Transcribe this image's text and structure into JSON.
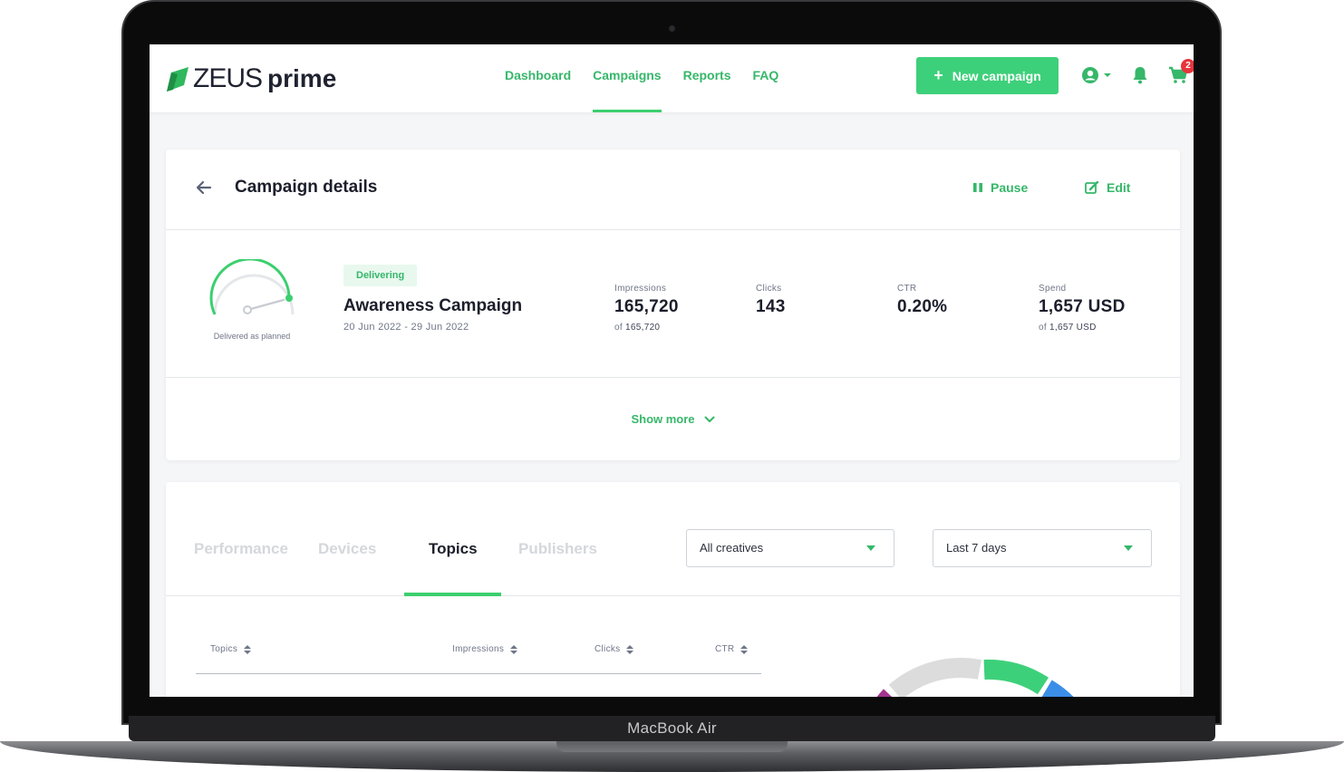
{
  "device": {
    "label": "MacBook Air"
  },
  "header": {
    "logo_main": "ZEUS",
    "logo_sub": "prime",
    "nav": [
      {
        "label": "Dashboard"
      },
      {
        "label": "Campaigns"
      },
      {
        "label": "Reports"
      },
      {
        "label": "FAQ"
      }
    ],
    "active_nav": "Campaigns",
    "new_campaign_label": "New campaign",
    "cart_count": "2",
    "icons": [
      "user-circle-icon",
      "bell-icon",
      "cart-icon"
    ]
  },
  "campaign": {
    "page_title": "Campaign details",
    "pause_label": "Pause",
    "edit_label": "Edit",
    "gauge_label": "Delivered as planned",
    "status": "Delivering",
    "name": "Awareness Campaign",
    "dates": "20 Jun 2022 - 29 Jun 2022",
    "metrics": [
      {
        "label": "Impressions",
        "value": "165,720",
        "sub_prefix": "of",
        "sub_value": "165,720"
      },
      {
        "label": "Clicks",
        "value": "143"
      },
      {
        "label": "CTR",
        "value": "0.20%"
      },
      {
        "label": "Spend",
        "value": "1,657 USD",
        "sub_prefix": "of",
        "sub_value": "1,657 USD"
      }
    ],
    "show_more_label": "Show more"
  },
  "breakdown": {
    "tabs": [
      {
        "label": "Performance"
      },
      {
        "label": "Devices"
      },
      {
        "label": "Topics"
      },
      {
        "label": "Publishers"
      }
    ],
    "active_tab": "Topics",
    "creative_filter": "All creatives",
    "date_filter": "Last 7 days",
    "columns": [
      "Topics",
      "Impressions",
      "Clicks",
      "CTR"
    ]
  },
  "colors": {
    "accent": "#3dd07a",
    "text_dark": "#1b1e2b",
    "badge_red": "#e8343b",
    "donut_segments": [
      "#dcdcdc",
      "#3dd07a",
      "#3b8ee8",
      "#a5348f"
    ]
  }
}
